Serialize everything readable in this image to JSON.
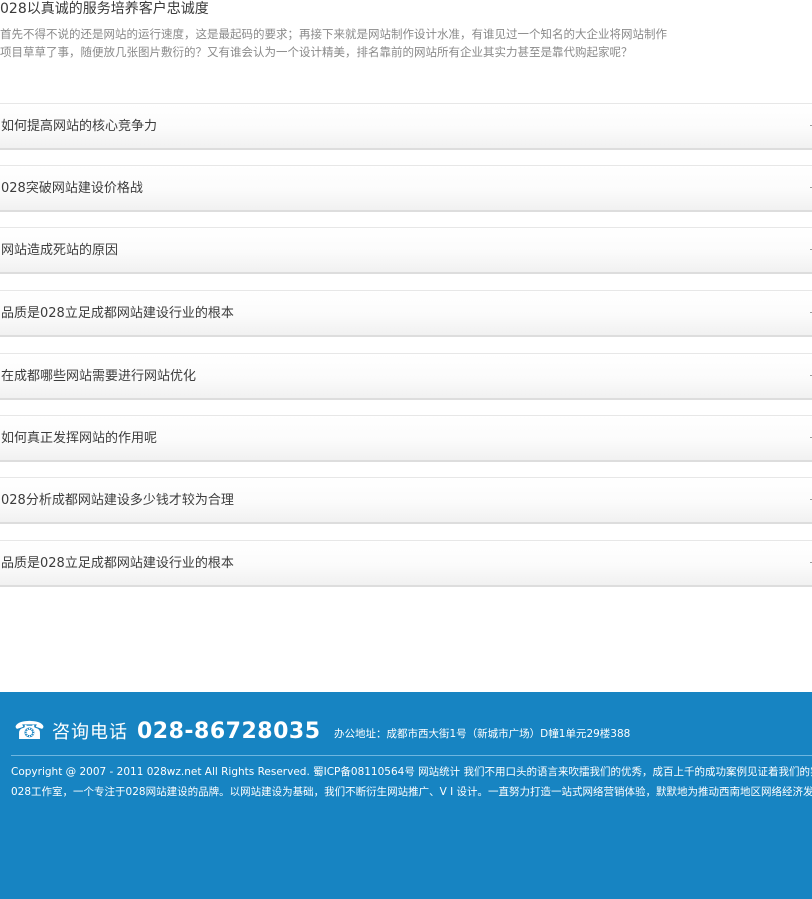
{
  "intro": {
    "title": "028以真诚的服务培养客户忠诚度",
    "line1": "首先不得不说的还是网站的运行速度，这是最起码的要求；再接下来就是网站制作设计水准，有谁见过一个知名的大企业将网站制作",
    "line2": "项目草草了事，随便放几张图片敷衍的？又有谁会认为一个设计精美，排名靠前的网站所有企业其实力甚至是靠代购起家呢？"
  },
  "faq": {
    "items": [
      {
        "label": "如何提高网站的核心竞争力"
      },
      {
        "label": "028突破网站建设价格战"
      },
      {
        "label": "网站造成死站的原因"
      },
      {
        "label": "品质是028立足成都网站建设行业的根本"
      },
      {
        "label": "在成都哪些网站需要进行网站优化"
      },
      {
        "label": "如何真正发挥网站的作用呢"
      },
      {
        "label": "028分析成都网站建设多少钱才较为合理"
      },
      {
        "label": "品质是028立足成都网站建设行业的根本"
      }
    ]
  },
  "footer": {
    "phone_icon": "telephone-icon",
    "phone_label": "咨询电话",
    "phone_number": "028-86728035",
    "address": "办公地址：成都市西大街1号（新城市广场）D幢1单元29楼388",
    "copyright": "Copyright @ 2007 - 2011 028wz.net All Rights Reserved. 蜀ICP备08110564号 网站统计  我们不用口头的语言来吹擂我们的优秀，成百上千的成功案例见证着我们的实力",
    "about": "028工作室，一个专注于028网站建设的品牌。以网站建设为基础，我们不断衍生网站推广、V I 设计。一直努力打造一站式网络营销体验，默默地为推动西南地区网络经济发展"
  },
  "colors": {
    "footer_bg": "#1784c2",
    "divider": "#6fb6df",
    "intro_text": "#8a8a8a"
  }
}
